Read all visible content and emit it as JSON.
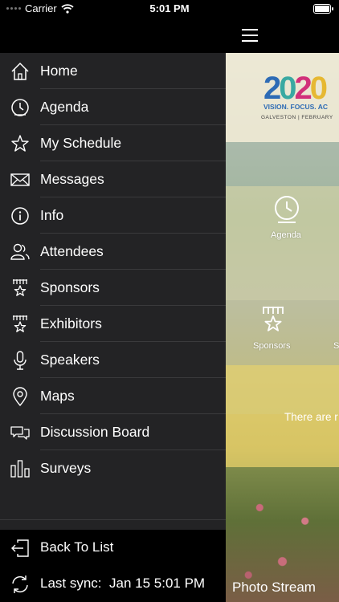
{
  "status_bar": {
    "carrier": "Carrier",
    "time": "5:01 PM"
  },
  "menu": {
    "items": [
      {
        "label": "Home",
        "icon": "home-icon"
      },
      {
        "label": "Agenda",
        "icon": "clock-icon"
      },
      {
        "label": "My Schedule",
        "icon": "star-icon"
      },
      {
        "label": "Messages",
        "icon": "envelope-icon"
      },
      {
        "label": "Info",
        "icon": "info-icon"
      },
      {
        "label": "Attendees",
        "icon": "people-icon"
      },
      {
        "label": "Sponsors",
        "icon": "sponsor-star-icon"
      },
      {
        "label": "Exhibitors",
        "icon": "sponsor-star-icon"
      },
      {
        "label": "Speakers",
        "icon": "microphone-icon"
      },
      {
        "label": "Maps",
        "icon": "map-pin-icon"
      },
      {
        "label": "Discussion Board",
        "icon": "chat-bubbles-icon"
      },
      {
        "label": "Surveys",
        "icon": "bar-chart-icon"
      }
    ],
    "footer": {
      "back_label": "Back To List",
      "sync_label": "Last sync:",
      "sync_time": "Jan 15 5:01 PM"
    }
  },
  "content": {
    "logo_text": "2020",
    "tagline": "VISION. FOCUS. AC",
    "dateline": "GALVESTON | FEBRUARY",
    "tiles": [
      {
        "label": "Agenda"
      },
      {
        "label": "Sponsors"
      }
    ],
    "sponsors_cutoff_label": "S",
    "notice_text": "There are r",
    "photo_stream_label": "Photo Stream"
  },
  "colors": {
    "drawer_bg": "#232325",
    "footer_bg": "#000000",
    "separator": "#3a3a3c"
  }
}
